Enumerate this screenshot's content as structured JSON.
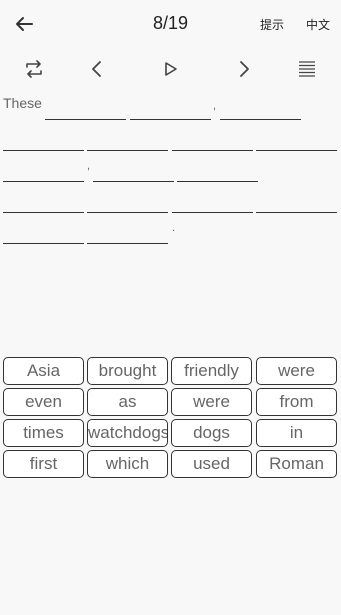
{
  "header": {
    "progress": "8/19",
    "hint_label": "提示",
    "lang_label": "中文"
  },
  "toolbar": {
    "icons": [
      "repeat-icon",
      "chevron-left-icon",
      "play-icon",
      "chevron-right-icon",
      "list-icon"
    ]
  },
  "sentence": {
    "first_word": "These",
    "punctuation": [
      ",",
      ",",
      "."
    ]
  },
  "word_bank": [
    [
      "Asia",
      "brought",
      "friendly",
      "were"
    ],
    [
      "even",
      "as",
      "were",
      "from"
    ],
    [
      "times",
      "watchdogs",
      "dogs",
      "in"
    ],
    [
      "first",
      "which",
      "used",
      "Roman"
    ]
  ]
}
